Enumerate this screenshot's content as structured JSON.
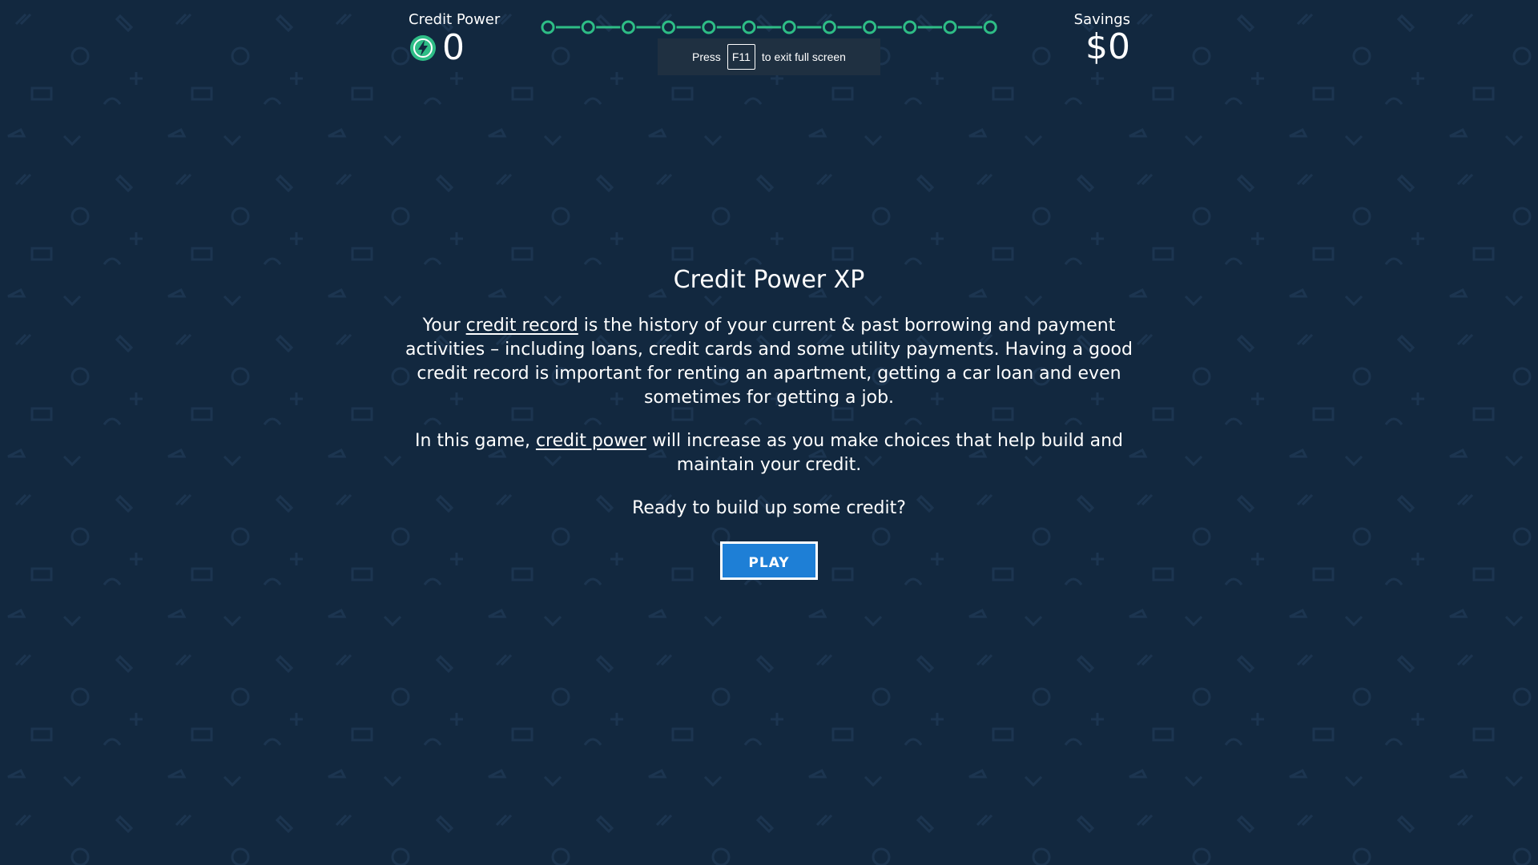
{
  "hud": {
    "credit_power_label": "Credit Power",
    "credit_power_value": "0",
    "savings_label": "Savings",
    "savings_value": "$0",
    "progress_steps_total": 12,
    "progress_steps_completed": 0
  },
  "fullscreen_hint": {
    "prefix": "Press",
    "key": "F11",
    "suffix": "to exit full screen"
  },
  "intro": {
    "title": "Credit Power XP",
    "p1_before": "Your ",
    "p1_link": "credit record",
    "p1_after": " is the history of your current & past borrowing and payment activities – including loans, credit cards and some utility payments. Having a good credit record is important for renting an apartment, getting a car loan and even sometimes for getting a job.",
    "p2_before": "In this game, ",
    "p2_link": "credit power",
    "p2_after": " will increase as you make choices that help build and maintain your credit.",
    "p3": "Ready to build up some credit?",
    "play_label": "PLAY"
  },
  "icons": {
    "credit_power": "lightning-bolt-icon"
  },
  "colors": {
    "background": "#12283f",
    "accent_green": "#2ebd86",
    "button_blue": "#1e7fd6"
  }
}
